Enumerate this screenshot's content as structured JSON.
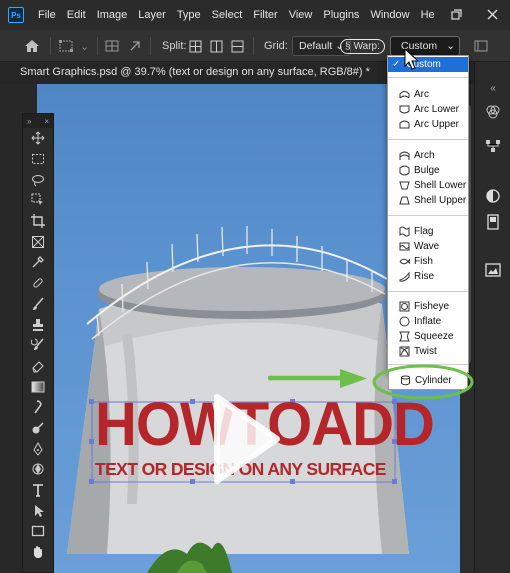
{
  "app": {
    "logo_text": "Ps"
  },
  "menu": [
    "File",
    "Edit",
    "Image",
    "Layer",
    "Type",
    "Select",
    "Filter",
    "View",
    "Plugins",
    "Window",
    "He"
  ],
  "options": {
    "split_label": "Split:",
    "grid_label": "Grid:",
    "grid_value": "Default",
    "warp_label": "Warp:",
    "warp_value": "Custom"
  },
  "document": {
    "tab_title": "Smart Graphics.psd @ 39.7% (text or design on any surface, RGB/8#) *"
  },
  "warp_menu": {
    "selected": "Custom",
    "groups": [
      [
        "Arc",
        "Arc Lower",
        "Arc Upper"
      ],
      [
        "Arch",
        "Bulge",
        "Shell Lower",
        "Shell Upper"
      ],
      [
        "Flag",
        "Wave",
        "Fish",
        "Rise"
      ],
      [
        "Fisheye",
        "Inflate",
        "Squeeze",
        "Twist"
      ],
      [
        "Cylinder"
      ]
    ]
  },
  "canvas_text": {
    "headline": "HOWTOADD",
    "subline": "TEXT OR DESIGN ON ANY SURFACE"
  },
  "colors": {
    "accent_blue": "#1f6fd6",
    "highlight_green": "#6cc04a",
    "text_red": "#b5262b"
  }
}
